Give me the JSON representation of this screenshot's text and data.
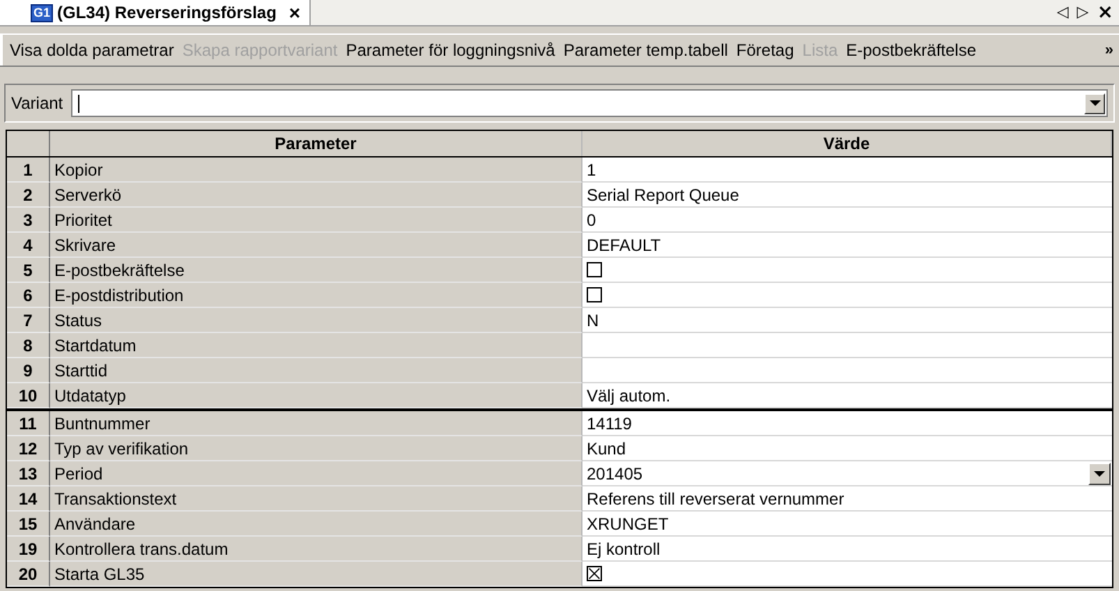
{
  "tab": {
    "icon_text": "G1",
    "title": "(GL34) Reverseringsförslag",
    "close": "×"
  },
  "nav": {
    "prev": "◁",
    "next": "▷",
    "close": "×"
  },
  "toolbar": [
    {
      "label": "Visa dolda parametrar",
      "disabled": false
    },
    {
      "label": "Skapa rapportvariant",
      "disabled": true
    },
    {
      "label": "Parameter för loggningsnivå",
      "disabled": false
    },
    {
      "label": "Parameter temp.tabell",
      "disabled": false
    },
    {
      "label": "Företag",
      "disabled": false
    },
    {
      "label": "Lista",
      "disabled": true
    },
    {
      "label": "E-postbekräftelse",
      "disabled": false
    }
  ],
  "overflow": "»",
  "variant": {
    "label": "Variant"
  },
  "table": {
    "columns": [
      "Parameter",
      "Värde"
    ],
    "sections": [
      [
        {
          "num": "1",
          "name": "Kopior",
          "kind": "text",
          "value": "1"
        },
        {
          "num": "2",
          "name": "Serverkö",
          "kind": "text",
          "value": "Serial Report Queue"
        },
        {
          "num": "3",
          "name": "Prioritet",
          "kind": "text",
          "value": "0"
        },
        {
          "num": "4",
          "name": "Skrivare",
          "kind": "text",
          "value": "DEFAULT"
        },
        {
          "num": "5",
          "name": "E-postbekräftelse",
          "kind": "checkbox",
          "checked": false
        },
        {
          "num": "6",
          "name": "E-postdistribution",
          "kind": "checkbox",
          "checked": false
        },
        {
          "num": "7",
          "name": "Status",
          "kind": "text",
          "value": "N"
        },
        {
          "num": "8",
          "name": "Startdatum",
          "kind": "text"
        },
        {
          "num": "9",
          "name": "Starttid",
          "kind": "text"
        },
        {
          "num": "10",
          "name": "Utdatatyp",
          "kind": "text",
          "value": "Välj autom."
        }
      ],
      [
        {
          "num": "11",
          "name": "Buntnummer",
          "kind": "text",
          "value": "14119"
        },
        {
          "num": "12",
          "name": "Typ av verifikation",
          "kind": "text",
          "value": "Kund"
        },
        {
          "num": "13",
          "name": "Period",
          "kind": "dropdown",
          "value": "201405"
        },
        {
          "num": "14",
          "name": "Transaktionstext",
          "kind": "text",
          "value": "Referens till reverserat vernummer"
        },
        {
          "num": "15",
          "name": "Användare",
          "kind": "text",
          "value": "XRUNGET"
        },
        {
          "num": "19",
          "name": "Kontrollera trans.datum",
          "kind": "text",
          "value": "Ej kontroll"
        },
        {
          "num": "20",
          "name": "Starta GL35",
          "kind": "checkbox",
          "checked": true
        }
      ]
    ]
  }
}
